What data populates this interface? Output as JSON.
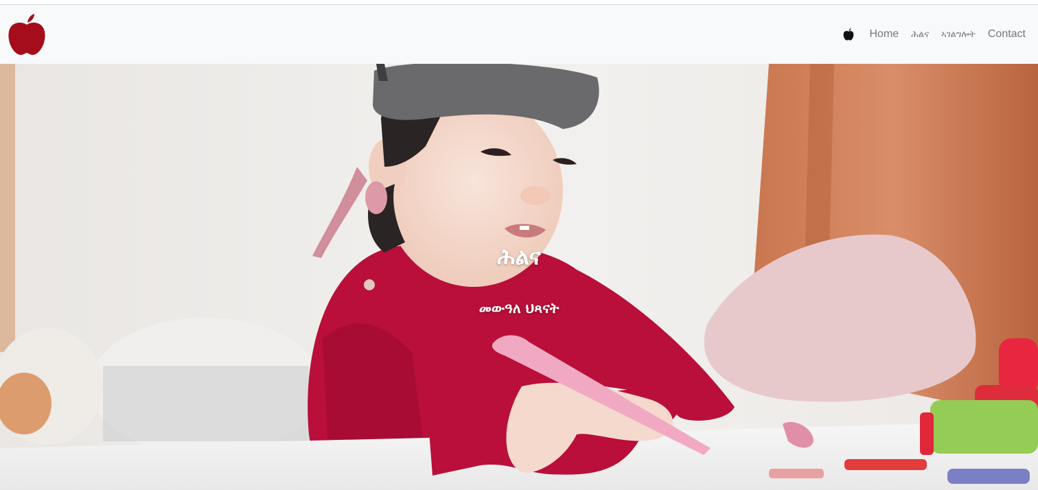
{
  "header": {
    "logo_icon": "apple-logo-icon",
    "brand_color": "#a50d1c"
  },
  "nav": {
    "icon": "apple-icon",
    "items": [
      {
        "label": "Home"
      },
      {
        "label": "ሕልና"
      },
      {
        "label": "ኣገልግሎት"
      },
      {
        "label": "Contact"
      }
    ]
  },
  "hero": {
    "title": "ሕልና",
    "subtitle": "መውዓለ ህጻናት",
    "image": "child-drawing-photo"
  }
}
